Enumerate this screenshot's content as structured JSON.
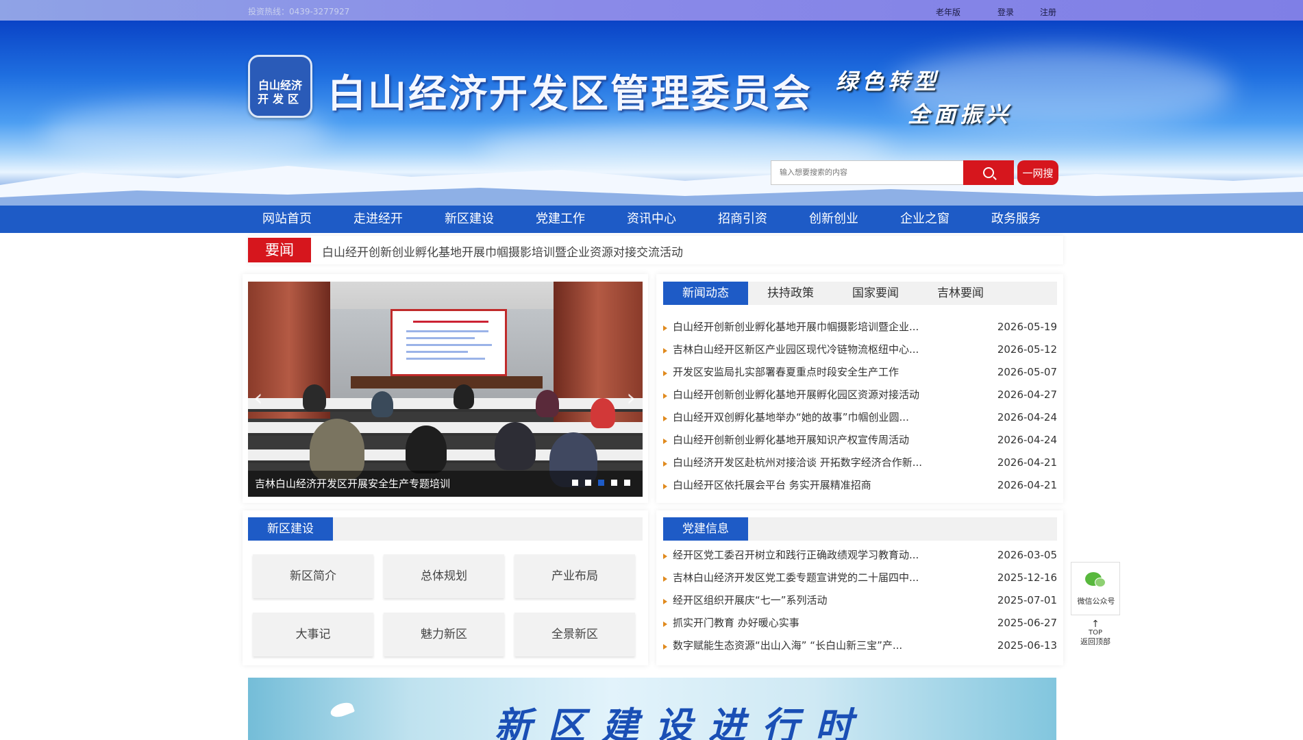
{
  "topbar": {
    "hotline": "投资热线：0439-3277927",
    "elder": "老年版",
    "login": "登录",
    "register": "注册"
  },
  "header": {
    "logo_line1": "白山经济",
    "logo_line2": "开发区",
    "title": "白山经济开发区管理委员会",
    "slogan1": "绿色转型",
    "slogan2": "全面振兴"
  },
  "search": {
    "placeholder": "输入想要搜索的内容",
    "one_search": "一网搜"
  },
  "nav": [
    "网站首页",
    "走进经开",
    "新区建设",
    "党建工作",
    "资讯中心",
    "招商引资",
    "创新创业",
    "企业之窗",
    "政务服务"
  ],
  "news_bar": {
    "tag": "要闻",
    "headline": "白山经开创新创业孵化基地开展巾帼摄影培训暨企业资源对接交流活动"
  },
  "slider": {
    "caption": "吉林白山经济开发区开展安全生产专题培训",
    "dots": 5,
    "active_dot": 3
  },
  "news_tabs": [
    "新闻动态",
    "扶持政策",
    "国家要闻",
    "吉林要闻"
  ],
  "news_list": [
    {
      "title": "白山经开创新创业孵化基地开展巾帼摄影培训暨企业...",
      "date": "2026-05-19"
    },
    {
      "title": "吉林白山经开区新区产业园区现代冷链物流枢纽中心...",
      "date": "2026-05-12"
    },
    {
      "title": "开发区安监局扎实部署春夏重点时段安全生产工作",
      "date": "2026-05-07"
    },
    {
      "title": "白山经开创新创业孵化基地开展孵化园区资源对接活动",
      "date": "2026-04-27"
    },
    {
      "title": "白山经开双创孵化基地举办“她的故事”巾帼创业圆...",
      "date": "2026-04-24"
    },
    {
      "title": "白山经开创新创业孵化基地开展知识产权宣传周活动",
      "date": "2026-04-24"
    },
    {
      "title": "白山经济开发区赴杭州对接洽谈 开拓数字经济合作新...",
      "date": "2026-04-21"
    },
    {
      "title": "白山经开区依托展会平台 务实开展精准招商",
      "date": "2026-04-21"
    }
  ],
  "xinqu": {
    "label": "新区建设",
    "buttons": [
      "新区简介",
      "总体规划",
      "产业布局",
      "大事记",
      "魅力新区",
      "全景新区"
    ]
  },
  "party": {
    "label": "党建信息",
    "list": [
      {
        "title": "经开区党工委召开树立和践行正确政绩观学习教育动...",
        "date": "2026-03-05"
      },
      {
        "title": "吉林白山经济开发区党工委专题宣讲党的二十届四中...",
        "date": "2025-12-16"
      },
      {
        "title": "经开区组织开展庆“七一”系列活动",
        "date": "2025-07-01"
      },
      {
        "title": "抓实开门教育 办好暖心实事",
        "date": "2025-06-27"
      },
      {
        "title": "数字赋能生态资源“出山入海” “长白山新三宝”产...",
        "date": "2025-06-13"
      }
    ]
  },
  "float": {
    "wechat": "微信公众号",
    "top": "TOP",
    "back_top": "返回顶部"
  },
  "bottom_banner": {
    "title": "新区建设进行时"
  },
  "colors": {
    "nav_blue": "#1e5bc6",
    "brand_red": "#d6161d",
    "bullet_orange": "#e08a1e"
  }
}
